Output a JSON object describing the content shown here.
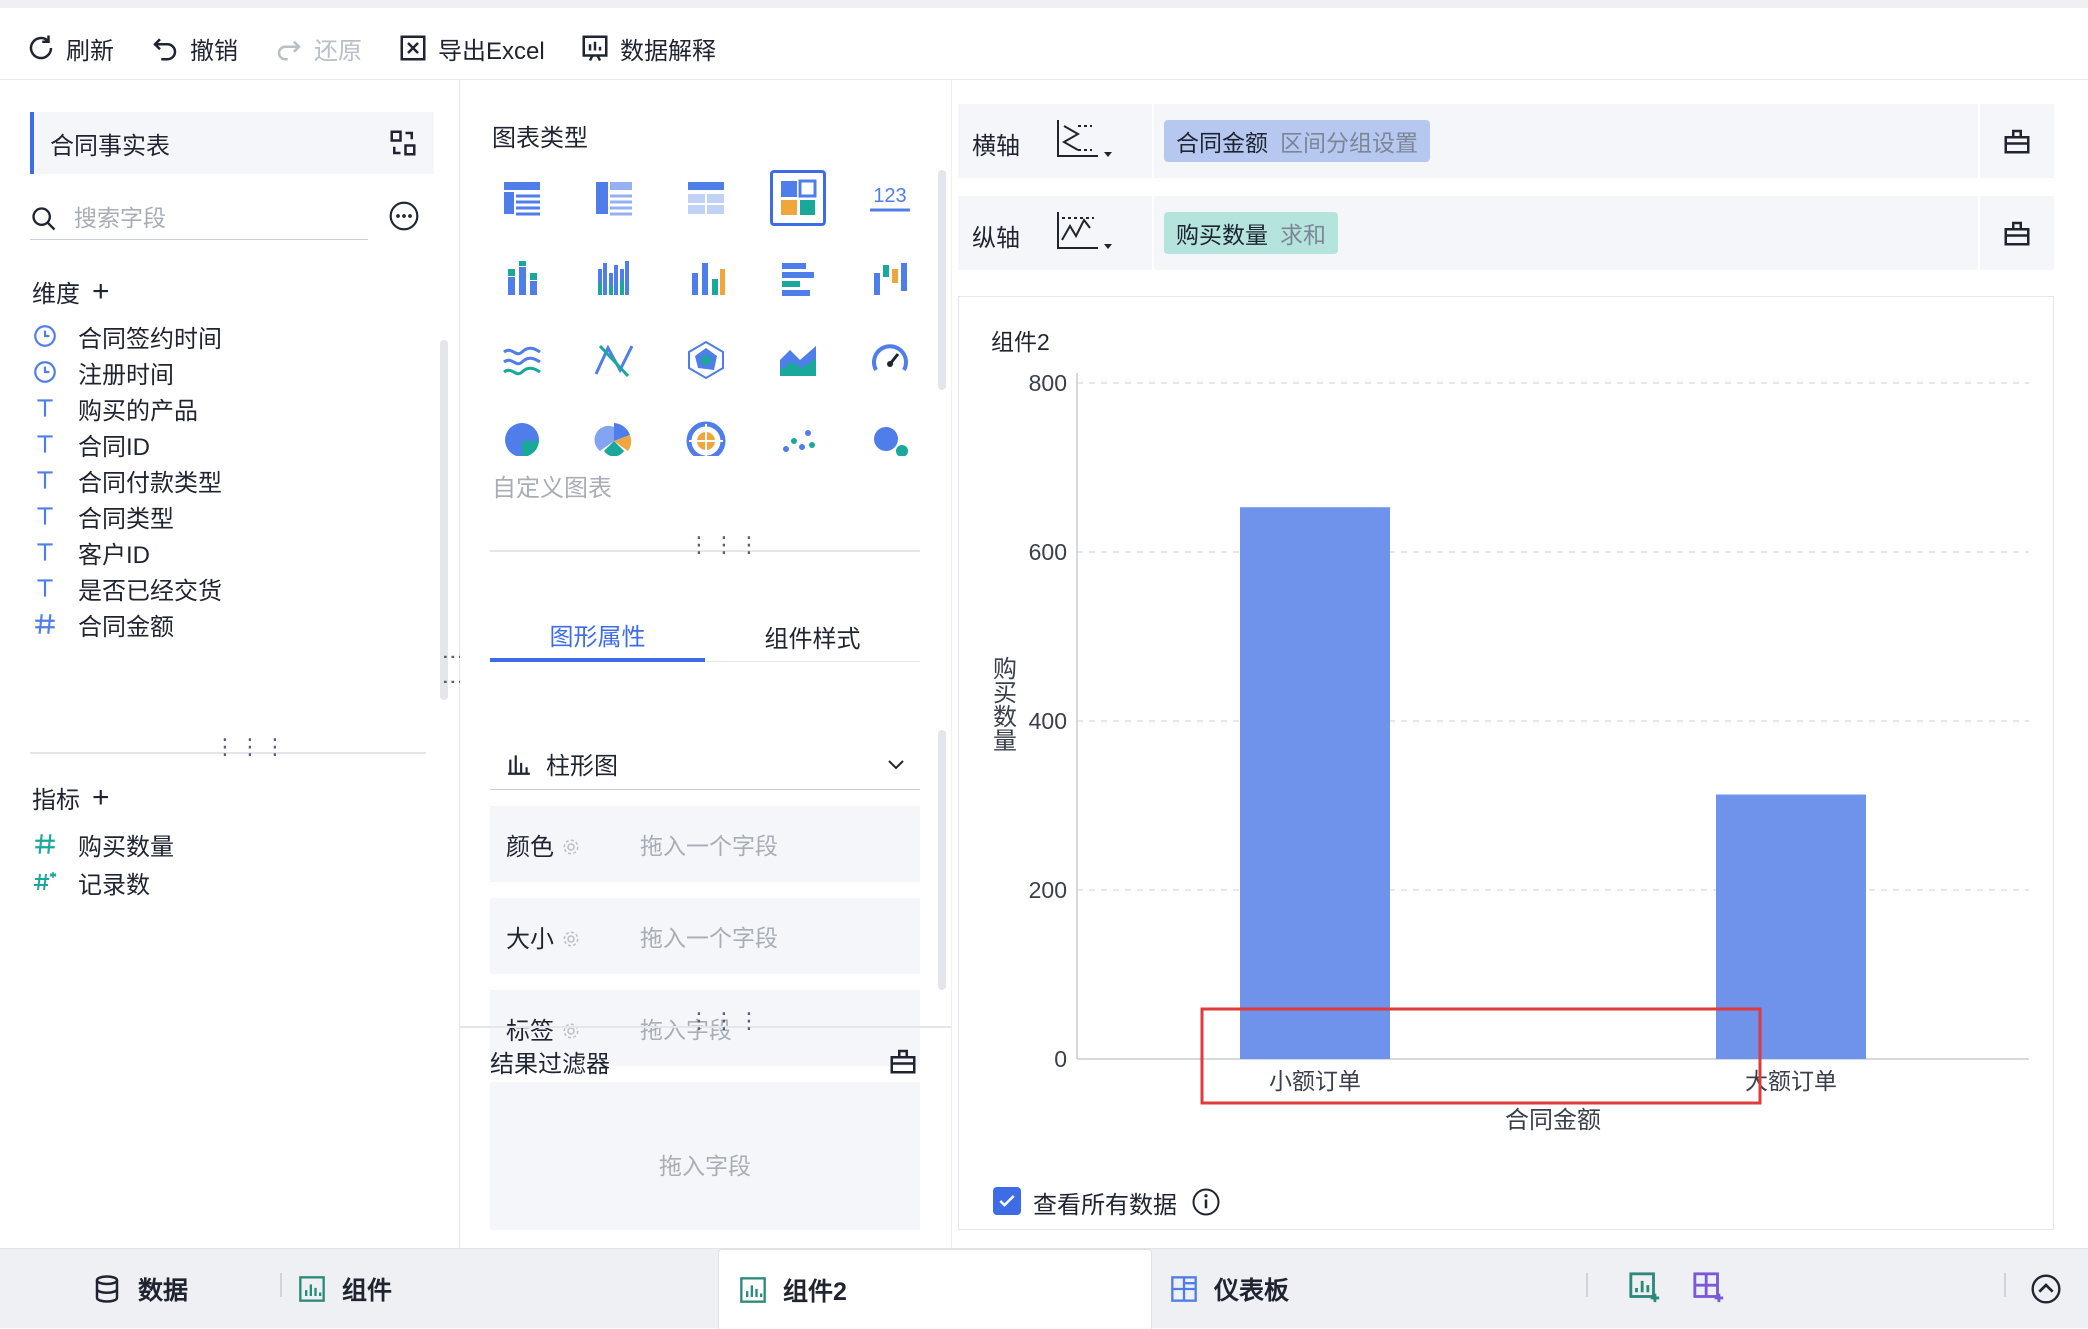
{
  "toolbar": {
    "refresh": "刷新",
    "undo": "撤销",
    "redo": "还原",
    "export_excel": "导出Excel",
    "data_explain": "数据解释"
  },
  "left": {
    "dataset_name": "合同事实表",
    "search_placeholder": "搜索字段",
    "dimension_title": "维度",
    "dimensions": [
      {
        "label": "合同签约时间",
        "icon": "clock-icon"
      },
      {
        "label": "注册时间",
        "icon": "clock-icon"
      },
      {
        "label": "购买的产品",
        "icon": "text-type-icon"
      },
      {
        "label": "合同ID",
        "icon": "text-type-icon"
      },
      {
        "label": "合同付款类型",
        "icon": "text-type-icon"
      },
      {
        "label": "合同类型",
        "icon": "text-type-icon"
      },
      {
        "label": "客户ID",
        "icon": "text-type-icon"
      },
      {
        "label": "是否已经交货",
        "icon": "text-type-icon"
      },
      {
        "label": "合同金额",
        "icon": "number-type-icon"
      }
    ],
    "measure_title": "指标",
    "measures": [
      {
        "label": "购买数量",
        "icon": "number-type-icon"
      },
      {
        "label": "记录数",
        "icon": "record-count-icon"
      }
    ]
  },
  "middle": {
    "chart_type_title": "图表类型",
    "custom_chart": "自定义图表",
    "tabs": [
      "图形属性",
      "组件样式"
    ],
    "chart_select": "柱形图",
    "props": [
      {
        "label": "颜色",
        "hint": "拖入一个字段"
      },
      {
        "label": "大小",
        "hint": "拖入一个字段"
      },
      {
        "label": "标签",
        "hint": "拖入字段"
      }
    ],
    "filter_title": "结果过滤器",
    "filter_hint": "拖入字段"
  },
  "axes": {
    "x_label": "横轴",
    "x_field": "合同金额",
    "x_setting": "区间分组设置",
    "y_label": "纵轴",
    "y_field": "购买数量",
    "y_agg": "求和"
  },
  "chart": {
    "widget_title": "组件2",
    "view_all_label": "查看所有数据",
    "view_all_checked": true
  },
  "chart_data": {
    "type": "bar",
    "categories": [
      "小额订单",
      "大额订单"
    ],
    "values": [
      653,
      313
    ],
    "xlabel": "合同金额",
    "ylabel": "购买数量",
    "ylim": [
      0,
      800
    ],
    "yticks": [
      0,
      200,
      400,
      600,
      800
    ],
    "bar_color": "#6f93eb",
    "grid": true
  },
  "bottom": {
    "data_tab": "数据",
    "component_tab": "组件",
    "active_tab": "组件2",
    "dashboard_tab": "仪表板"
  },
  "colors": {
    "accent": "#3d6ce6",
    "highlight_box": "#e03a3a",
    "x_pill": "#b6c8f0",
    "y_pill": "#b4e4dc"
  }
}
